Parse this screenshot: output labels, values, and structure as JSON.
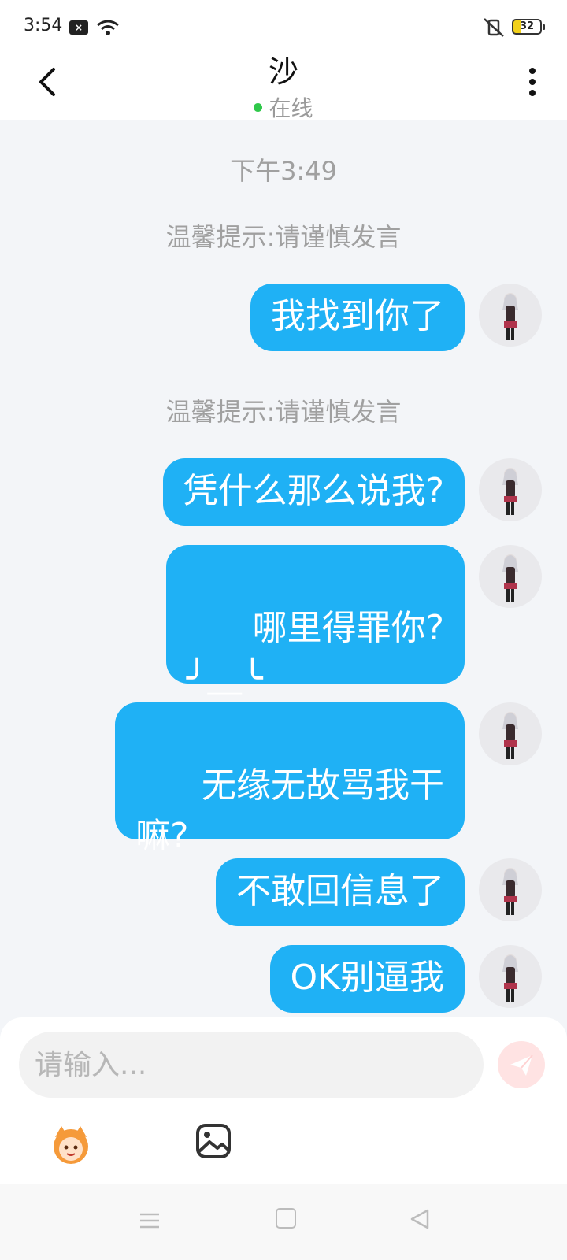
{
  "status_bar": {
    "time": "3:54",
    "battery": "32",
    "icons": [
      "notification-icon",
      "wifi-icon",
      "vibrate-mute-icon",
      "battery-icon"
    ]
  },
  "header": {
    "title": "沙",
    "status": "在线",
    "status_color": "#2fc84a"
  },
  "chat": {
    "time_label": "下午3:49",
    "tip": "温馨提示:请谨慎发言",
    "messages": [
      "我找到你了",
      "凭什么那么说我?",
      "哪里得罪你?\n╯＿╰",
      "无缘无故骂我干\n嘛?",
      "不敢回信息了",
      "OK别逼我"
    ],
    "bubble_color": "#1fb1f5"
  },
  "input": {
    "placeholder": "请输入..."
  }
}
